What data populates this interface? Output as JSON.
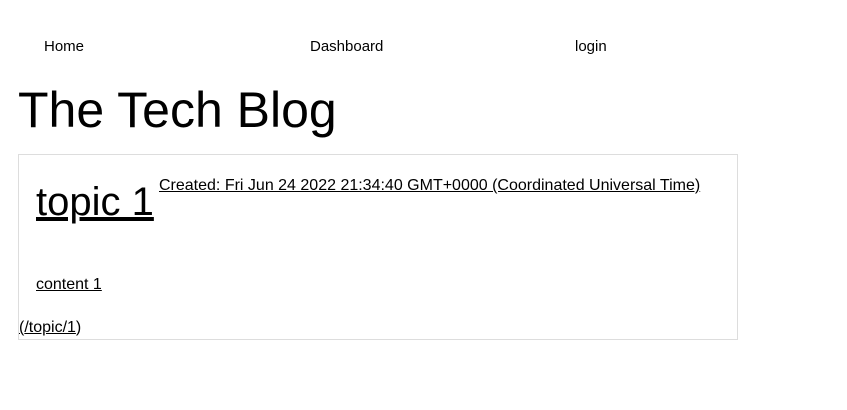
{
  "nav": {
    "home_label": "Home",
    "dashboard_label": "Dashboard",
    "login_label": "login"
  },
  "site": {
    "title": "The Tech Blog"
  },
  "posts": [
    {
      "title": "topic 1",
      "created": "Created: Fri Jun 24 2022 21:34:40 GMT+0000 (Coordinated Universal Time)",
      "content": "content 1",
      "link_open": "(",
      "link_text": "/topic/1",
      "link_close": ")"
    }
  ]
}
